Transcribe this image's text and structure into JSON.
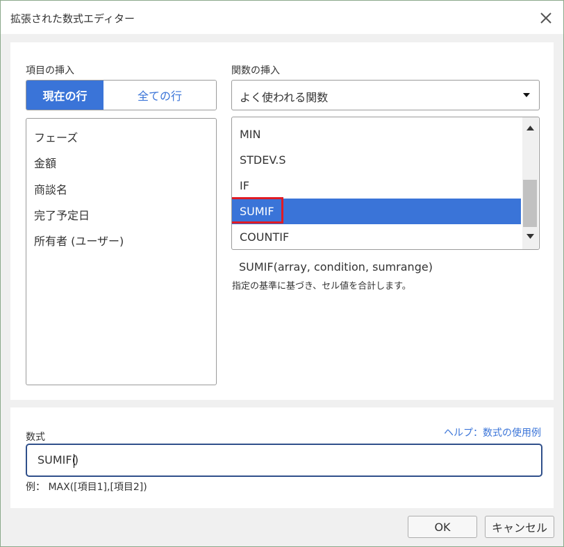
{
  "window": {
    "title": "拡張された数式エディター"
  },
  "left": {
    "label": "項目の挿入",
    "toggle": {
      "active": "現在の行",
      "inactive": "全ての行"
    },
    "fields": [
      "フェーズ",
      "金額",
      "商談名",
      "完了予定日",
      "所有者 (ユーザー)"
    ]
  },
  "right": {
    "label": "関数の挿入",
    "category": "よく使われる関数",
    "functions": [
      "MIN",
      "STDEV.S",
      "IF",
      "SUMIF",
      "COUNTIF"
    ],
    "selected": "SUMIF",
    "signature": "SUMIF(array, condition, sumrange)",
    "description": "指定の基準に基づき、セル値を合計します。"
  },
  "formula": {
    "label": "数式",
    "help_link": "ヘルプ：数式の使用例",
    "value_before_caret": "SUMIF(",
    "value_after_caret": ")",
    "example": "例：  MAX([項目1],[項目2])"
  },
  "buttons": {
    "ok": "OK",
    "cancel": "キャンセル"
  },
  "colors": {
    "accent": "#3a74d8",
    "highlight": "#e01b24",
    "input_border": "#2f4f8a"
  }
}
